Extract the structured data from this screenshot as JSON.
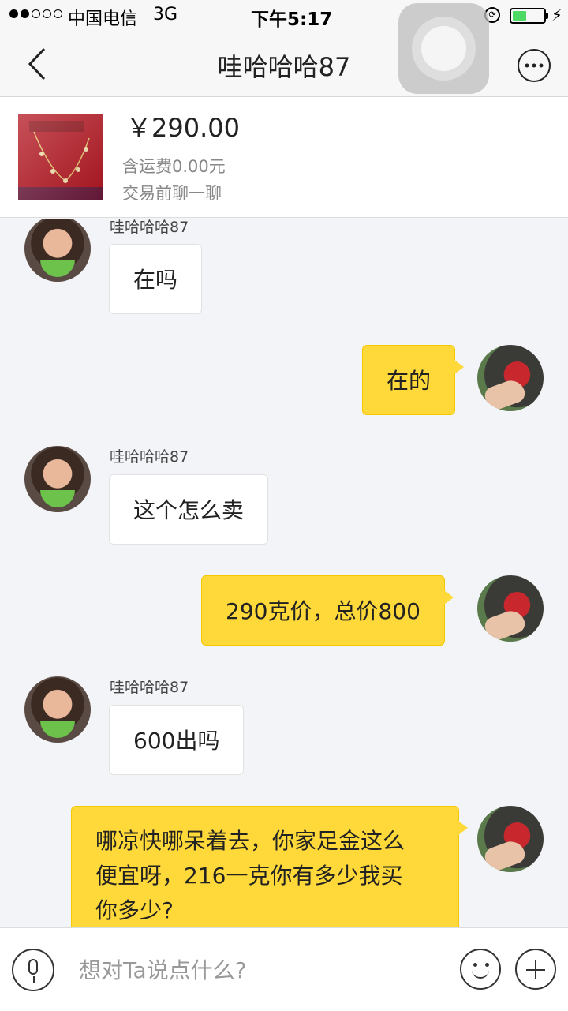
{
  "status_bar": {
    "carrier": "中国电信",
    "network": "3G",
    "time": "下午5:17",
    "battery_level": 0.45,
    "battery_color": "#4cd964"
  },
  "nav": {
    "title": "哇哈哈哈87",
    "back_icon": "chevron-left-icon",
    "more_icon": "ellipsis-icon"
  },
  "product": {
    "price": "￥290.00",
    "shipping": "含运费0.00元",
    "hint": "交易前聊一聊"
  },
  "chat": {
    "messages": [
      {
        "from": "other",
        "sender": "哇哈哈哈87",
        "text": "在吗"
      },
      {
        "from": "me",
        "text": "在的"
      },
      {
        "from": "other",
        "sender": "哇哈哈哈87",
        "text": "这个怎么卖"
      },
      {
        "from": "me",
        "text": "290克价，总价800"
      },
      {
        "from": "other",
        "sender": "哇哈哈哈87",
        "text": "600出吗"
      },
      {
        "from": "me",
        "lines": [
          "哪凉快哪呆着去，你家足金这么",
          "便宜呀，216一克你有多少我买",
          "你多少?"
        ]
      }
    ]
  },
  "input_bar": {
    "placeholder": "想对Ta说点什么?",
    "mic_icon": "microphone-icon",
    "emoji_icon": "emoji-icon",
    "plus_icon": "plus-icon"
  },
  "colors": {
    "accent": "#ffd93a",
    "background": "#f3f4f8"
  }
}
